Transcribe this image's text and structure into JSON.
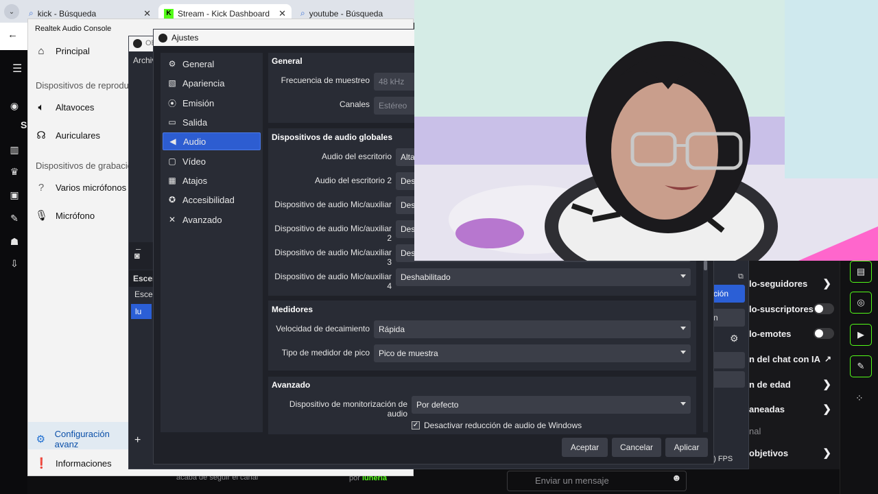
{
  "browser": {
    "tabs": [
      {
        "label": "kick - Búsqueda",
        "icon": "search-icon"
      },
      {
        "label": "Stream - Kick Dashboard",
        "icon": "kick-logo-icon"
      },
      {
        "label": "youtube - Búsqueda",
        "icon": "search-icon"
      }
    ],
    "close_glyph": "✕"
  },
  "realtek": {
    "title": "Realtek Audio Console",
    "main": "Principal",
    "playback_section": "Dispositivos de reproduc",
    "playback_items": [
      "Altavoces",
      "Auriculares"
    ],
    "recording_section": "Dispositivos de grabación",
    "recording_items": [
      "Varios micrófonos",
      "Micrófono"
    ],
    "advanced_config": "Configuración avanz",
    "info": "Informaciones"
  },
  "obs_main": {
    "title_stub": "OB",
    "menu_stub": "Archiv",
    "scenes_header": "Escen",
    "scene_item": "Escen",
    "selected_source": "lu",
    "fps": "4) FPS"
  },
  "settings": {
    "title": "Ajustes",
    "nav": [
      {
        "label": "General",
        "icon": "gear-icon"
      },
      {
        "label": "Apariencia",
        "icon": "appearance-icon"
      },
      {
        "label": "Emisión",
        "icon": "broadcast-icon"
      },
      {
        "label": "Salida",
        "icon": "output-icon"
      },
      {
        "label": "Audio",
        "icon": "speaker-icon"
      },
      {
        "label": "Vídeo",
        "icon": "monitor-icon"
      },
      {
        "label": "Atajos",
        "icon": "keyboard-icon"
      },
      {
        "label": "Accesibilidad",
        "icon": "accessibility-icon"
      },
      {
        "label": "Avanzado",
        "icon": "wrench-icon"
      }
    ],
    "selected_nav": "Audio",
    "general": {
      "title": "General",
      "sample_rate_label": "Frecuencia de muestreo",
      "sample_rate_value": "48 kHz",
      "channels_label": "Canales",
      "channels_value": "Estéreo"
    },
    "global_audio": {
      "title": "Dispositivos de audio globales",
      "rows": [
        {
          "label": "Audio del escritorio",
          "value": "Altav"
        },
        {
          "label": "Audio del escritorio 2",
          "value": "Desh"
        },
        {
          "label": "Dispositivo de audio Mic/auxiliar",
          "value": "Desh"
        },
        {
          "label": "Dispositivo de audio Mic/auxiliar 2",
          "value": "Desh"
        },
        {
          "label": "Dispositivo de audio Mic/auxiliar 3",
          "value": "Desh"
        },
        {
          "label": "Dispositivo de audio Mic/auxiliar 4",
          "value": "Deshabilitado"
        }
      ]
    },
    "meters": {
      "title": "Medidores",
      "decay_label": "Velocidad de decaimiento",
      "decay_value": "Rápida",
      "peak_label": "Tipo de medidor de pico",
      "peak_value": "Pico de muestra"
    },
    "advanced": {
      "title": "Avanzado",
      "monitor_label": "Dispositivo de monitorización de audio",
      "monitor_value": "Por defecto",
      "ducking_label": "Desactivar reducción de audio de Windows",
      "ducking_checked": "✓"
    },
    "buttons": {
      "ok": "Aceptar",
      "cancel": "Cancelar",
      "apply": "Aplicar"
    }
  },
  "kick": {
    "panel_rows": [
      "lo-seguidores",
      "lo-suscriptores",
      "lo-emotes",
      "n del chat con IA",
      "n de edad",
      "aneadas",
      "nal",
      "objetivos"
    ],
    "obs_side_buttons": [
      "ción",
      "n"
    ],
    "chat_placeholder": "Enviar un mensaje",
    "activity_1": "acaba de seguir el canal",
    "activity_2_prefix": "por",
    "activity_2_user": "luheria",
    "letter_s": "S",
    "accent": "#53fc18"
  }
}
